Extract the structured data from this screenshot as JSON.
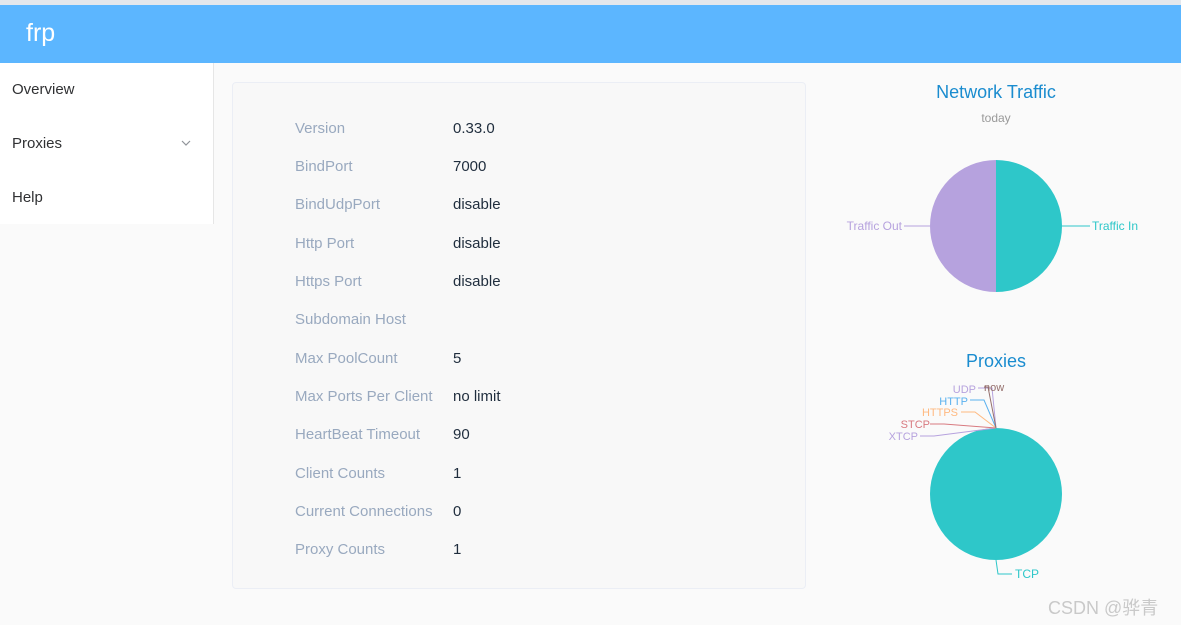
{
  "app": {
    "title": "frp"
  },
  "sidebar": {
    "items": [
      {
        "label": "Overview"
      },
      {
        "label": "Proxies"
      },
      {
        "label": "Help"
      }
    ]
  },
  "overview": {
    "rows": [
      {
        "key": "Version",
        "value": "0.33.0"
      },
      {
        "key": "BindPort",
        "value": "7000"
      },
      {
        "key": "BindUdpPort",
        "value": "disable"
      },
      {
        "key": "Http Port",
        "value": "disable"
      },
      {
        "key": "Https Port",
        "value": "disable"
      },
      {
        "key": "Subdomain Host",
        "value": ""
      },
      {
        "key": "Max PoolCount",
        "value": "5"
      },
      {
        "key": "Max Ports Per Client",
        "value": "no limit"
      },
      {
        "key": "HeartBeat Timeout",
        "value": "90"
      },
      {
        "key": "Client Counts",
        "value": "1"
      },
      {
        "key": "Current Connections",
        "value": "0"
      },
      {
        "key": "Proxy Counts",
        "value": "1"
      }
    ]
  },
  "chart_data": [
    {
      "type": "pie",
      "title": "Network Traffic",
      "subtitle": "today",
      "categories": [
        "Traffic In",
        "Traffic Out"
      ],
      "values": [
        50,
        50
      ],
      "colors": [
        "#2ec7c9",
        "#b6a2de"
      ]
    },
    {
      "type": "pie",
      "title": "Proxies",
      "categories": [
        "TCP",
        "XTCP",
        "STCP",
        "HTTPS",
        "HTTP",
        "UDP",
        "now"
      ],
      "values": [
        1,
        0,
        0,
        0,
        0,
        0,
        0
      ],
      "colors": [
        "#2ec7c9",
        "#b6a2de",
        "#d87a80",
        "#ffb980",
        "#5ab1ef",
        "#b6a2de",
        "#95706d"
      ]
    }
  ],
  "watermark": "CSDN @骅青"
}
